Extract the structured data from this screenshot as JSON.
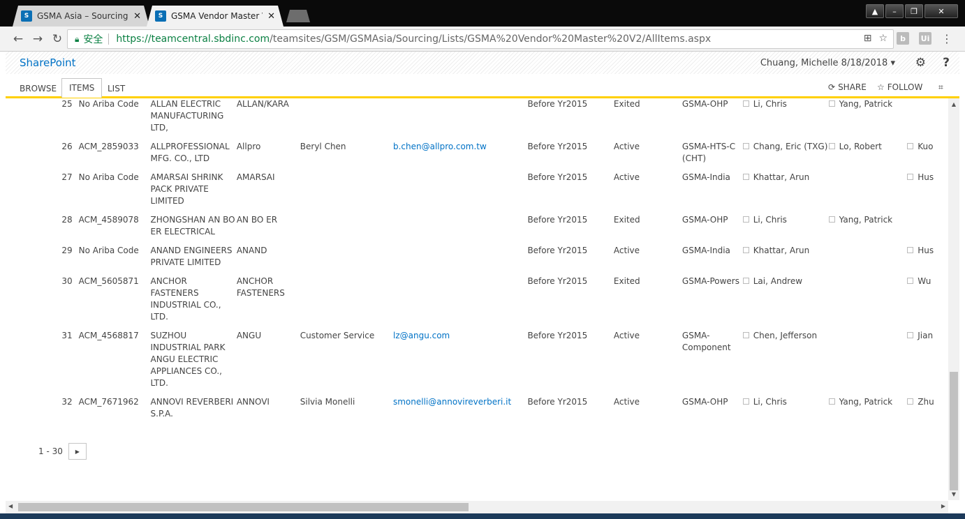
{
  "browser": {
    "tabs": [
      {
        "title": "GSMA Asia – Sourcing -",
        "active": false
      },
      {
        "title": "GSMA Vendor Master V",
        "active": true
      }
    ],
    "secure_label": "安全",
    "url_host": "https://teamcentral.sbdinc.com",
    "url_path": "/teamsites/GSM/GSMAsia/Sourcing/Lists/GSMA%20Vendor%20Master%20V2/AllItems.aspx"
  },
  "suite": {
    "brand": "SharePoint",
    "user": "Chuang, Michelle 8/18/2018 ▾"
  },
  "ribbon": {
    "tabs": [
      "BROWSE",
      "ITEMS",
      "LIST"
    ],
    "share": "SHARE",
    "follow": "FOLLOW"
  },
  "rows": [
    {
      "num": "25",
      "code": "No Ariba Code",
      "name": "ALLAN ELECTRIC MANUFACTURING LTD,",
      "short": "ALLAN/KARA",
      "contact": "",
      "email": "",
      "since": "Before Yr2015",
      "status": "Exited",
      "team": "GSMA-OHP",
      "p1": "Li, Chris",
      "p2": "Yang, Patrick",
      "p3": ""
    },
    {
      "num": "26",
      "code": "ACM_2859033",
      "name": "ALLPROFESSIONAL MFG. CO., LTD",
      "short": "Allpro",
      "contact": "Beryl Chen",
      "email": "b.chen@allpro.com.tw",
      "since": "Before Yr2015",
      "status": "Active",
      "team": "GSMA-HTS-C (CHT)",
      "p1": "Chang, Eric (TXG)",
      "p2": "Lo, Robert",
      "p3": "Kuo"
    },
    {
      "num": "27",
      "code": "No Ariba Code",
      "name": "AMARSAI SHRINK PACK PRIVATE LIMITED",
      "short": "AMARSAI",
      "contact": "",
      "email": "",
      "since": "Before Yr2015",
      "status": "Active",
      "team": "GSMA-India",
      "p1": "Khattar, Arun",
      "p2": "",
      "p3": "Hus"
    },
    {
      "num": "28",
      "code": "ACM_4589078",
      "name": "ZHONGSHAN AN BO ER ELECTRICAL",
      "short": "AN BO ER",
      "contact": "",
      "email": "",
      "since": "Before Yr2015",
      "status": "Exited",
      "team": "GSMA-OHP",
      "p1": "Li, Chris",
      "p2": "Yang, Patrick",
      "p3": ""
    },
    {
      "num": "29",
      "code": "No Ariba Code",
      "name": "ANAND ENGINEERS PRIVATE LIMITED",
      "short": "ANAND",
      "contact": "",
      "email": "",
      "since": "Before Yr2015",
      "status": "Active",
      "team": "GSMA-India",
      "p1": "Khattar, Arun",
      "p2": "",
      "p3": "Hus"
    },
    {
      "num": "30",
      "code": "ACM_5605871",
      "name": "ANCHOR FASTENERS INDUSTRIAL CO., LTD.",
      "short": "ANCHOR FASTENERS",
      "contact": "",
      "email": "",
      "since": "Before Yr2015",
      "status": "Exited",
      "team": "GSMA-Powers",
      "p1": "Lai, Andrew",
      "p2": "",
      "p3": "Wu"
    },
    {
      "num": "31",
      "code": "ACM_4568817",
      "name": "SUZHOU INDUSTRIAL PARK ANGU ELECTRIC APPLIANCES CO., LTD.",
      "short": "ANGU",
      "contact": "Customer Service",
      "email": "lz@angu.com",
      "since": "Before Yr2015",
      "status": "Active",
      "team": "GSMA-Component",
      "p1": "Chen, Jefferson",
      "p2": "",
      "p3": "Jian"
    },
    {
      "num": "32",
      "code": "ACM_7671962",
      "name": "ANNOVI REVERBERI S.P.A.",
      "short": "ANNOVI",
      "contact": "Silvia Monelli",
      "email": "smonelli@annovireverberi.it",
      "since": "Before Yr2015",
      "status": "Active",
      "team": "GSMA-OHP",
      "p1": "Li, Chris",
      "p2": "Yang, Patrick",
      "p3": "Zhu"
    }
  ],
  "pager": {
    "range": "1 - 30"
  }
}
